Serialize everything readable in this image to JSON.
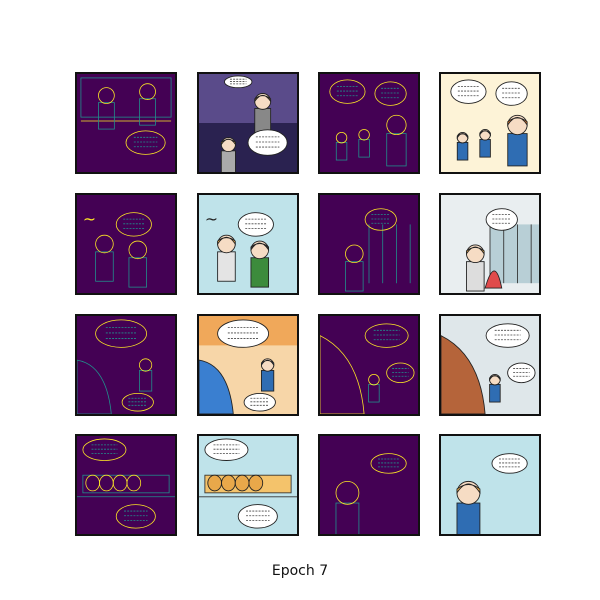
{
  "caption": "Epoch 7",
  "grid": {
    "rows": 4,
    "cols": 4,
    "column_kinds": [
      "edge-map",
      "original",
      "edge-map",
      "original"
    ]
  },
  "palette": {
    "edge_background": "#440154",
    "edge_line_teal": "#21918c",
    "edge_line_yellow": "#fde725",
    "edge_line_green": "#5ec962",
    "frame": "#111111",
    "sky_blue": "#bfe3ea",
    "hair_orange": "#f2b04a",
    "shirt_blue": "#2f6db3"
  },
  "tiles": [
    {
      "row": 0,
      "col": 0,
      "kind": "edge-map",
      "scene": "two-people-window"
    },
    {
      "row": 0,
      "col": 1,
      "kind": "original",
      "scene": "night-city-chat"
    },
    {
      "row": 0,
      "col": 2,
      "kind": "edge-map",
      "scene": "kids-shouting"
    },
    {
      "row": 0,
      "col": 3,
      "kind": "original",
      "scene": "kids-shouting"
    },
    {
      "row": 1,
      "col": 0,
      "kind": "edge-map",
      "scene": "sigh-two-people"
    },
    {
      "row": 1,
      "col": 1,
      "kind": "original",
      "scene": "sigh-two-people"
    },
    {
      "row": 1,
      "col": 2,
      "kind": "edge-map",
      "scene": "office-window"
    },
    {
      "row": 1,
      "col": 3,
      "kind": "original",
      "scene": "office-window"
    },
    {
      "row": 2,
      "col": 0,
      "kind": "edge-map",
      "scene": "blue-character-sunset"
    },
    {
      "row": 2,
      "col": 1,
      "kind": "original",
      "scene": "blue-character-sunset"
    },
    {
      "row": 2,
      "col": 2,
      "kind": "edge-map",
      "scene": "boat-storm"
    },
    {
      "row": 2,
      "col": 3,
      "kind": "original",
      "scene": "boat-storm"
    },
    {
      "row": 3,
      "col": 0,
      "kind": "edge-map",
      "scene": "bread-shelf"
    },
    {
      "row": 3,
      "col": 1,
      "kind": "original",
      "scene": "bread-shelf"
    },
    {
      "row": 3,
      "col": 2,
      "kind": "edge-map",
      "scene": "girl-portrait"
    },
    {
      "row": 3,
      "col": 3,
      "kind": "original",
      "scene": "girl-portrait"
    }
  ]
}
